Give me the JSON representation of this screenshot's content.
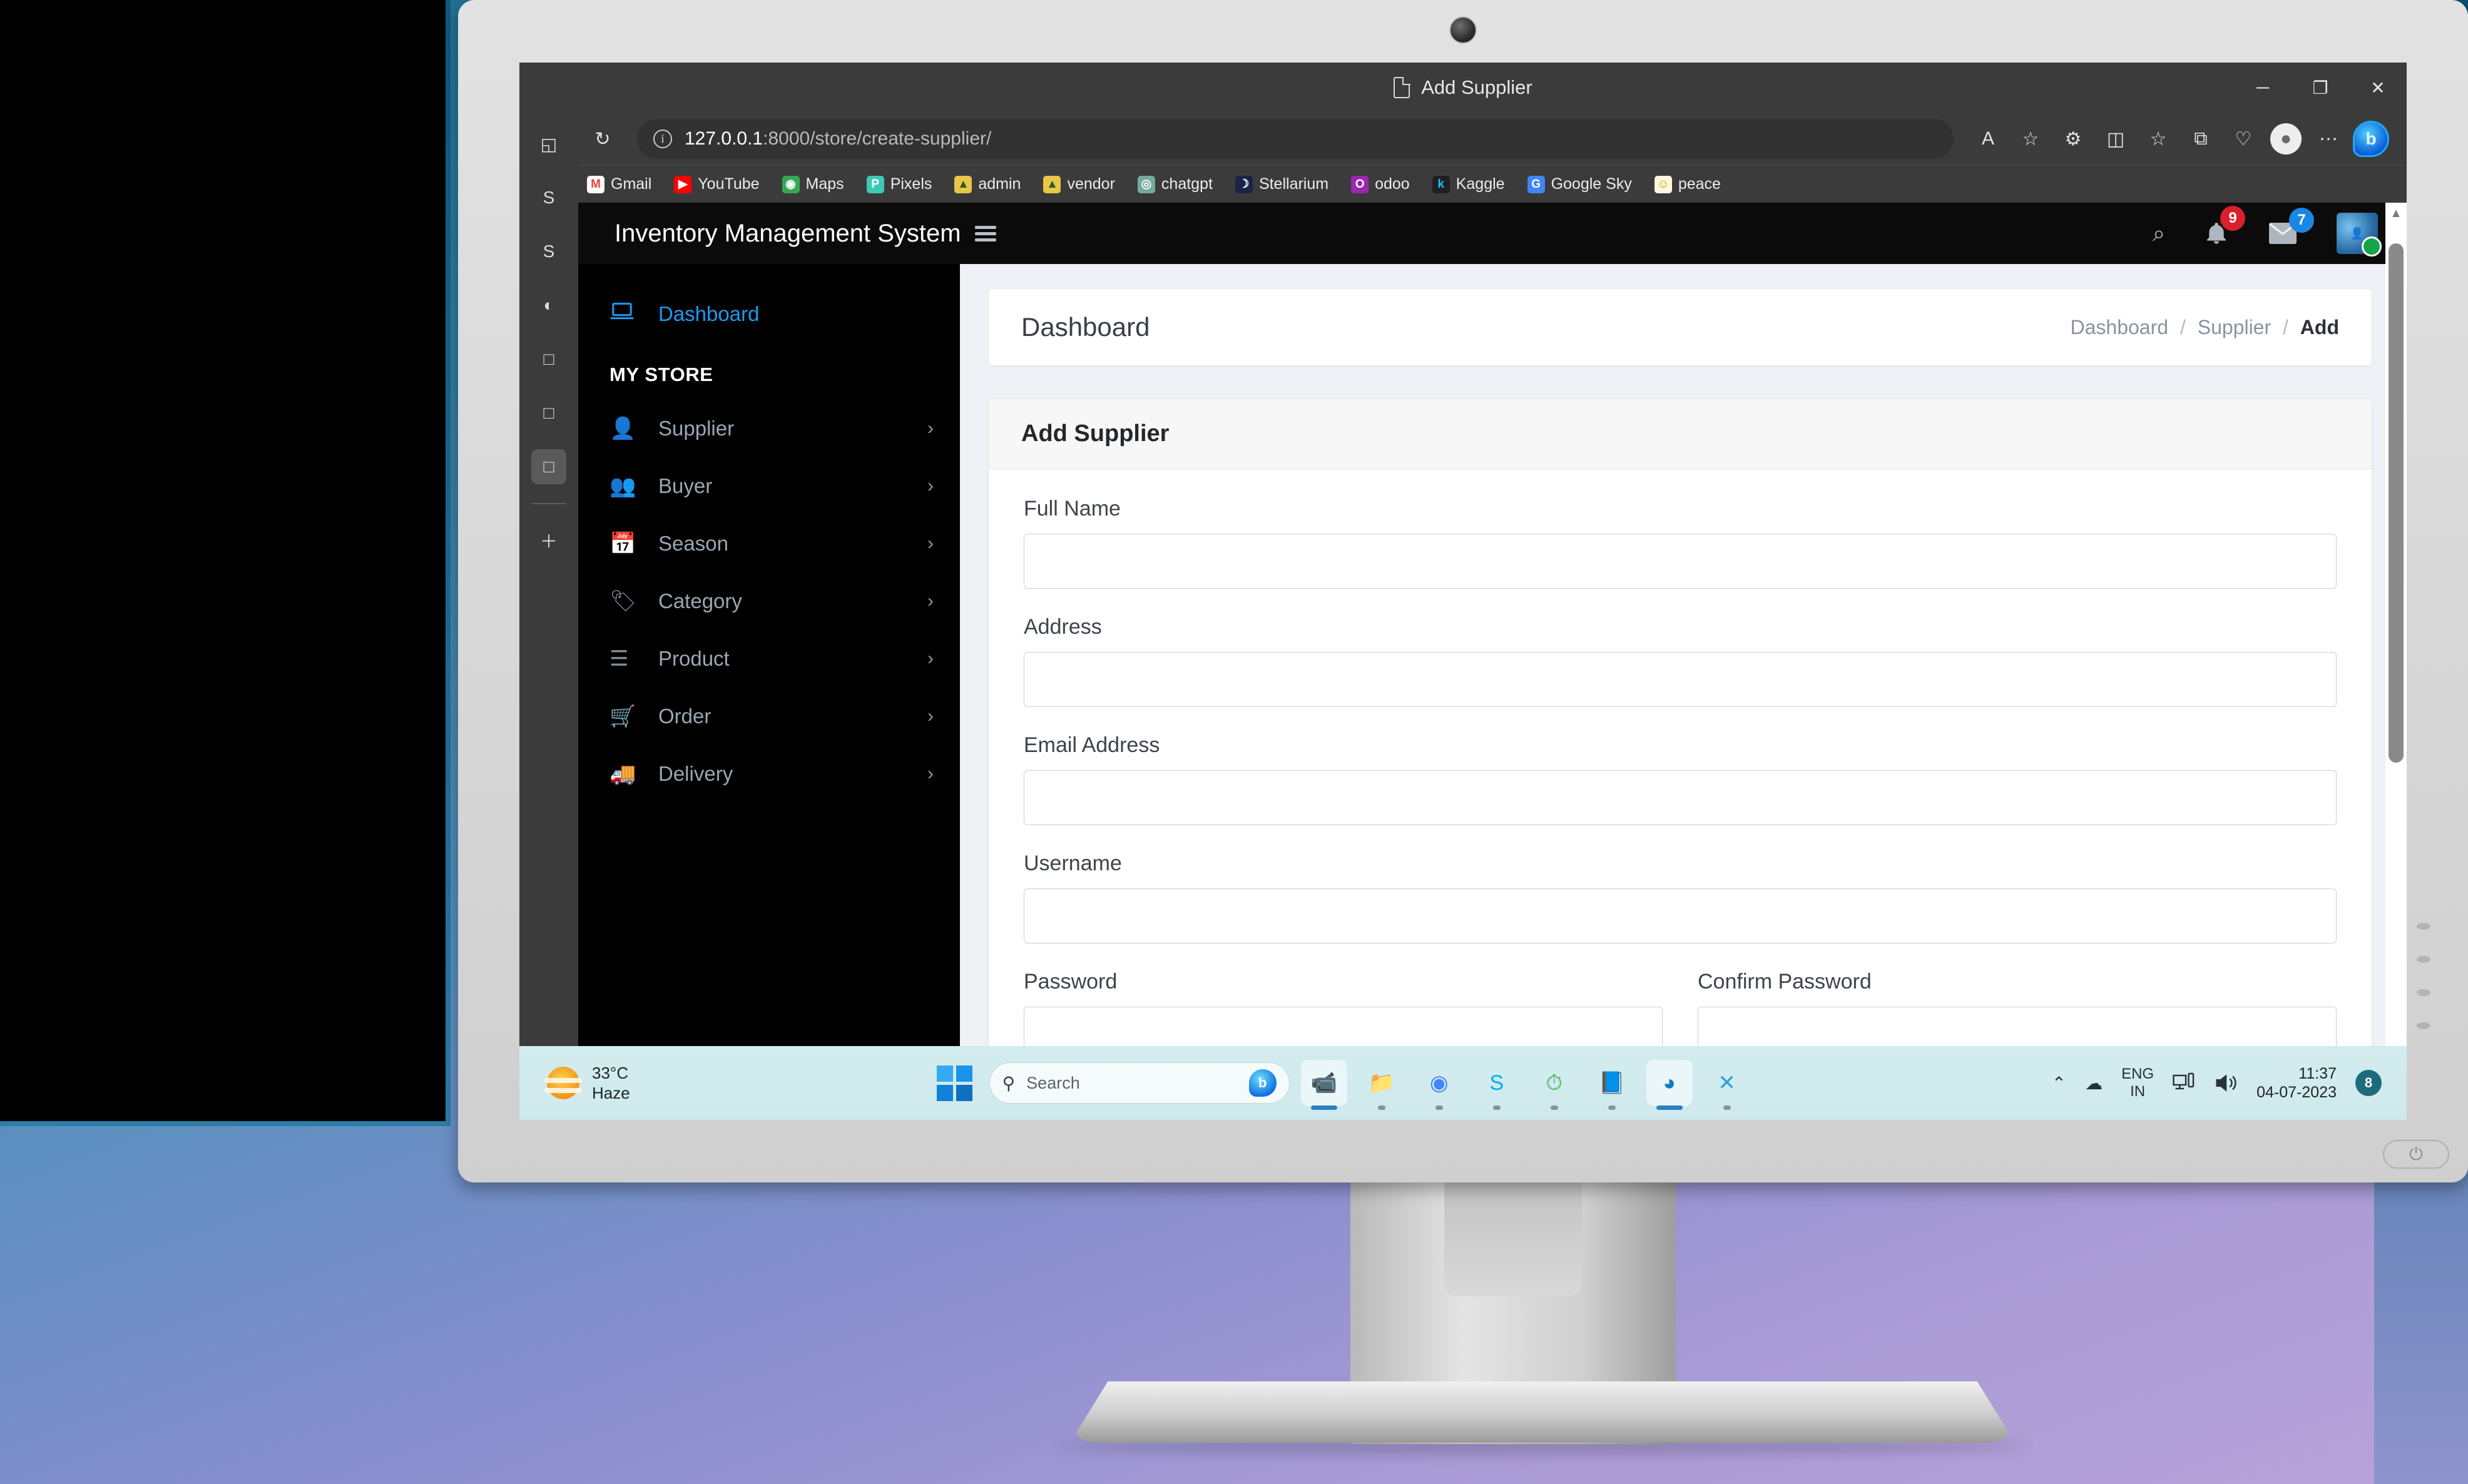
{
  "browser": {
    "tab_title": "Add Supplier",
    "url_host": "127.0.0.1",
    "url_rest": ":8000/store/create-supplier/",
    "window_controls": {
      "minimize": "─",
      "maximize": "❐",
      "close": "✕"
    },
    "nav": {
      "back": "←",
      "reload": "↻"
    },
    "toolbar_icons": [
      {
        "name": "read-aloud-icon",
        "glyph": "A"
      },
      {
        "name": "favorite-star-icon",
        "glyph": "☆"
      },
      {
        "name": "extensions-icon",
        "glyph": "⚙"
      },
      {
        "name": "split-screen-icon",
        "glyph": "◫"
      },
      {
        "name": "collections-icon",
        "glyph": "☆"
      },
      {
        "name": "add-tab-group-icon",
        "glyph": "⧉"
      },
      {
        "name": "browser-essentials-icon",
        "glyph": "♡"
      },
      {
        "name": "profile-icon",
        "glyph": "●"
      },
      {
        "name": "settings-more-icon",
        "glyph": "⋯"
      }
    ],
    "bing_label": "b",
    "bookmarks": [
      {
        "label": "Gmail",
        "icon": "M",
        "color": "#ea4335",
        "bg": "#ffffff"
      },
      {
        "label": "YouTube",
        "icon": "▶",
        "color": "#ffffff",
        "bg": "#ff0000"
      },
      {
        "label": "Maps",
        "icon": "◉",
        "color": "#ffffff",
        "bg": "#34a853"
      },
      {
        "label": "Pixels",
        "icon": "P",
        "color": "#ffffff",
        "bg": "#3ec9b4"
      },
      {
        "label": "admin",
        "icon": "▲",
        "color": "#2a5d1e",
        "bg": "#e8c64a"
      },
      {
        "label": "vendor",
        "icon": "▲",
        "color": "#2a5d1e",
        "bg": "#e8c64a"
      },
      {
        "label": "chatgpt",
        "icon": "◎",
        "color": "#ffffff",
        "bg": "#74aa9c"
      },
      {
        "label": "Stellarium",
        "icon": "☽",
        "color": "#ffffff",
        "bg": "#1b2348"
      },
      {
        "label": "odoo",
        "icon": "O",
        "color": "#ffffff",
        "bg": "#9c27b0"
      },
      {
        "label": "Kaggle",
        "icon": "k",
        "color": "#20beff",
        "bg": "#1f1f1f"
      },
      {
        "label": "Google Sky",
        "icon": "G",
        "color": "#ffffff",
        "bg": "#4285f4"
      },
      {
        "label": "peace",
        "icon": "☺",
        "color": "#c9a227",
        "bg": "#fff8dc"
      }
    ],
    "vertical_tabs": [
      {
        "name": "tab-list-icon",
        "glyph": "◱",
        "active": false
      },
      {
        "name": "skype-tab-inactive-icon",
        "glyph": "S",
        "active": false
      },
      {
        "name": "skype-tab-icon",
        "glyph": "S",
        "active": false
      },
      {
        "name": "stellarium-tab-icon",
        "glyph": "◐",
        "active": false
      },
      {
        "name": "page-tab-icon-1",
        "glyph": "□",
        "active": false
      },
      {
        "name": "page-tab-icon-2",
        "glyph": "□",
        "active": false
      },
      {
        "name": "page-tab-icon-3",
        "glyph": "□",
        "active": true
      },
      {
        "name": "new-tab-icon",
        "glyph": "＋",
        "active": false
      }
    ]
  },
  "app": {
    "title": "Inventory Management System",
    "header_icons": {
      "search": "⌕",
      "bell": "🔔",
      "bell_badge": "9",
      "mail": "✉",
      "mail_badge": "7"
    },
    "sidebar": {
      "dashboard": {
        "label": "Dashboard",
        "icon": "💻"
      },
      "section_title": "MY STORE",
      "items": [
        {
          "label": "Supplier",
          "icon": "👤",
          "chevron": "›"
        },
        {
          "label": "Buyer",
          "icon": "👥",
          "chevron": "›"
        },
        {
          "label": "Season",
          "icon": "📅",
          "chevron": "›"
        },
        {
          "label": "Category",
          "icon": "🏷",
          "chevron": "›"
        },
        {
          "label": "Product",
          "icon": "☰",
          "chevron": "›"
        },
        {
          "label": "Order",
          "icon": "🛒",
          "chevron": "›"
        },
        {
          "label": "Delivery",
          "icon": "🚚",
          "chevron": "›"
        }
      ]
    },
    "page": {
      "heading": "Dashboard",
      "breadcrumb": {
        "root": "Dashboard",
        "middle": "Supplier",
        "current": "Add",
        "separator": "/"
      },
      "card_title": "Add Supplier",
      "fields": [
        {
          "label": "Full Name",
          "value": "",
          "placeholder": ""
        },
        {
          "label": "Address",
          "value": "",
          "placeholder": ""
        },
        {
          "label": "Email Address",
          "value": "",
          "placeholder": ""
        },
        {
          "label": "Username",
          "value": "",
          "placeholder": ""
        }
      ],
      "password_row": [
        {
          "label": "Password",
          "value": "",
          "placeholder": ""
        },
        {
          "label": "Confirm Password",
          "value": "",
          "placeholder": ""
        }
      ]
    }
  },
  "taskbar": {
    "weather": {
      "temperature": "33°C",
      "condition": "Haze"
    },
    "search_placeholder": "Search",
    "apps": [
      {
        "name": "teams-icon",
        "glyph": "📹",
        "active": true,
        "color": "#6264a7"
      },
      {
        "name": "file-explorer-icon",
        "glyph": "📁",
        "active": false,
        "color": "#ffc83d"
      },
      {
        "name": "chrome-icon",
        "glyph": "◉",
        "active": false,
        "color": "#4285f4"
      },
      {
        "name": "skype-icon",
        "glyph": "S",
        "active": false,
        "color": "#00aff0"
      },
      {
        "name": "clock-icon",
        "glyph": "⏱",
        "active": false,
        "color": "#3bb143"
      },
      {
        "name": "notepad-icon",
        "glyph": "📘",
        "active": false,
        "color": "#4fc3e8"
      },
      {
        "name": "edge-icon",
        "glyph": "◕",
        "active": true,
        "color": "#0b7dc1"
      },
      {
        "name": "vscode-icon",
        "glyph": "✕",
        "active": false,
        "color": "#2f9fe0"
      }
    ],
    "tray": {
      "overflow": "⌃",
      "onedrive": "☁",
      "language": {
        "line1": "ENG",
        "line2": "IN"
      },
      "network": "🖥",
      "volume": "🔊",
      "time": "11:37",
      "date": "04-07-2023",
      "notification_count": "8"
    }
  },
  "monitor": {
    "power_glyph": "⏻"
  }
}
